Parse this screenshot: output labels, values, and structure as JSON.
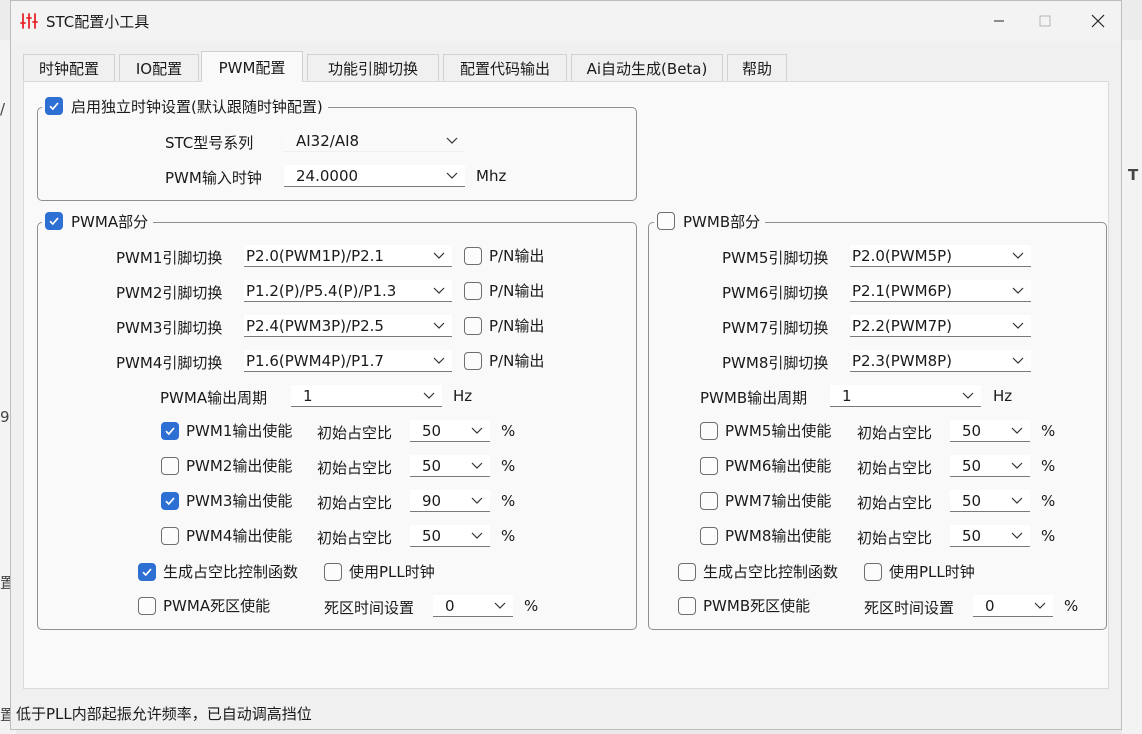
{
  "window": {
    "title": "STC配置小工具"
  },
  "tabs": [
    {
      "label": "时钟配置"
    },
    {
      "label": "IO配置"
    },
    {
      "label": "PWM配置"
    },
    {
      "label": "功能引脚切换"
    },
    {
      "label": "配置代码输出"
    },
    {
      "label": "Ai自动生成(Beta)"
    },
    {
      "label": "帮助"
    }
  ],
  "clock_group": {
    "legend": "启用独立时钟设置(默认跟随时钟配置)",
    "model_label": "STC型号系列",
    "model_value": "AI32/AI8",
    "input_clock_label": "PWM输入时钟",
    "input_clock_value": "24.0000",
    "input_clock_unit": "Mhz"
  },
  "pwma": {
    "legend": "PWMA部分",
    "pins": [
      {
        "label": "PWM1引脚切换",
        "value": "P2.0(PWM1P)/P2.1",
        "pn": "P/N输出"
      },
      {
        "label": "PWM2引脚切换",
        "value": "P1.2(P)/P5.4(P)/P1.3",
        "pn": "P/N输出"
      },
      {
        "label": "PWM3引脚切换",
        "value": "P2.4(PWM3P)/P2.5",
        "pn": "P/N输出"
      },
      {
        "label": "PWM4引脚切换",
        "value": "P1.6(PWM4P)/P1.7",
        "pn": "P/N输出"
      }
    ],
    "period_label": "PWMA输出周期",
    "period_value": "1",
    "period_unit": "Hz",
    "outputs": [
      {
        "label": "PWM1输出使能",
        "duty_label": "初始占空比",
        "duty": "50",
        "unit": "%"
      },
      {
        "label": "PWM2输出使能",
        "duty_label": "初始占空比",
        "duty": "50",
        "unit": "%"
      },
      {
        "label": "PWM3输出使能",
        "duty_label": "初始占空比",
        "duty": "90",
        "unit": "%"
      },
      {
        "label": "PWM4输出使能",
        "duty_label": "初始占空比",
        "duty": "50",
        "unit": "%"
      }
    ],
    "gen_func": "生成占空比控制函数",
    "use_pll": "使用PLL时钟",
    "deadzone": "PWMA死区使能",
    "deadtime_label": "死区时间设置",
    "deadtime_value": "0",
    "deadtime_unit": "%"
  },
  "pwmb": {
    "legend": "PWMB部分",
    "pins": [
      {
        "label": "PWM5引脚切换",
        "value": "P2.0(PWM5P)"
      },
      {
        "label": "PWM6引脚切换",
        "value": "P2.1(PWM6P)"
      },
      {
        "label": "PWM7引脚切换",
        "value": "P2.2(PWM7P)"
      },
      {
        "label": "PWM8引脚切换",
        "value": "P2.3(PWM8P)"
      }
    ],
    "period_label": "PWMB输出周期",
    "period_value": "1",
    "period_unit": "Hz",
    "outputs": [
      {
        "label": "PWM5输出使能",
        "duty_label": "初始占空比",
        "duty": "50",
        "unit": "%"
      },
      {
        "label": "PWM6输出使能",
        "duty_label": "初始占空比",
        "duty": "50",
        "unit": "%"
      },
      {
        "label": "PWM7输出使能",
        "duty_label": "初始占空比",
        "duty": "50",
        "unit": "%"
      },
      {
        "label": "PWM8输出使能",
        "duty_label": "初始占空比",
        "duty": "50",
        "unit": "%"
      }
    ],
    "gen_func": "生成占空比控制函数",
    "use_pll": "使用PLL时钟",
    "deadzone": "PWMB死区使能",
    "deadtime_label": "死区时间设置",
    "deadtime_value": "0",
    "deadtime_unit": "%"
  },
  "status": "低于PLL内部起振允许频率，已自动调高挡位",
  "background": {
    "left_1": "/",
    "left_2": "9",
    "left_3": "置",
    "left_4": "置",
    "right_1": "T"
  },
  "colors": {
    "accent": "#2e6fd4",
    "title_red": "#e8242b"
  }
}
